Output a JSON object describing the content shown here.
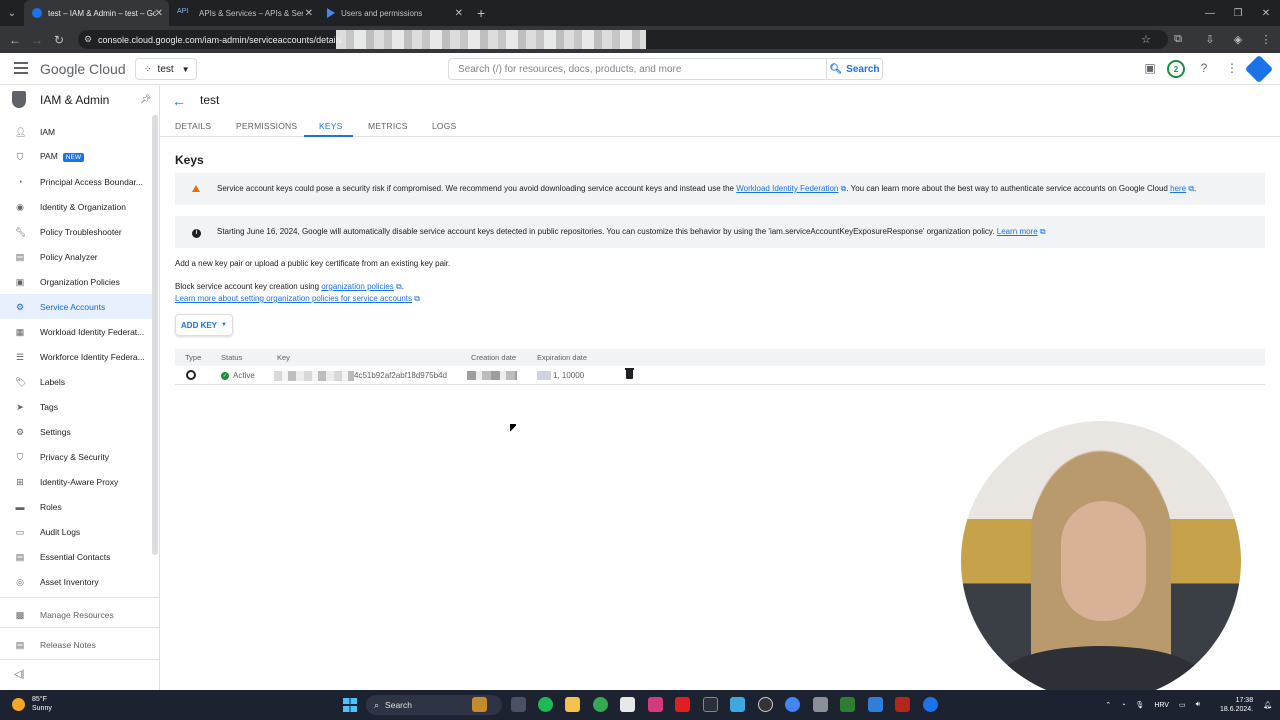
{
  "browser": {
    "tabs": [
      {
        "title": "test – IAM & Admin – test – Go",
        "active": true
      },
      {
        "title": "APIs & Services – APIs & Servic",
        "active": false
      },
      {
        "title": "Users and permissions",
        "active": false
      }
    ],
    "url": "console.cloud.google.com/iam-admin/serviceaccounts/details"
  },
  "header": {
    "logo": "Google Cloud",
    "project": "test",
    "search_placeholder": "Search (/) for resources, docs, products, and more",
    "search_button": "Search",
    "notification_count": "2"
  },
  "sidebar": {
    "title": "IAM & Admin",
    "items": [
      {
        "label": "IAM",
        "icon": "person-add-icon"
      },
      {
        "label": "PAM",
        "icon": "shield-icon",
        "badge": "NEW"
      },
      {
        "label": "Principal Access Boundar...",
        "icon": "policy-icon"
      },
      {
        "label": "Identity & Organization",
        "icon": "account-circle-icon"
      },
      {
        "label": "Policy Troubleshooter",
        "icon": "wrench-icon"
      },
      {
        "label": "Policy Analyzer",
        "icon": "document-search-icon"
      },
      {
        "label": "Organization Policies",
        "icon": "list-icon"
      },
      {
        "label": "Service Accounts",
        "icon": "service-account-icon",
        "active": true
      },
      {
        "label": "Workload Identity Federat...",
        "icon": "grid-icon"
      },
      {
        "label": "Workforce Identity Federa...",
        "icon": "list-icon"
      },
      {
        "label": "Labels",
        "icon": "label-icon"
      },
      {
        "label": "Tags",
        "icon": "tag-icon"
      },
      {
        "label": "Settings",
        "icon": "gear-icon"
      },
      {
        "label": "Privacy & Security",
        "icon": "shield-icon"
      },
      {
        "label": "Identity-Aware Proxy",
        "icon": "proxy-icon"
      },
      {
        "label": "Roles",
        "icon": "roles-icon"
      },
      {
        "label": "Audit Logs",
        "icon": "log-icon"
      },
      {
        "label": "Essential Contacts",
        "icon": "contacts-icon"
      },
      {
        "label": "Asset Inventory",
        "icon": "inventory-icon"
      }
    ],
    "footer_items": [
      {
        "label": "Manage Resources",
        "icon": "folder-icon"
      },
      {
        "label": "Release Notes",
        "icon": "notes-icon"
      }
    ]
  },
  "main": {
    "title": "test",
    "tabs": [
      "DETAILS",
      "PERMISSIONS",
      "KEYS",
      "METRICS",
      "LOGS"
    ],
    "active_tab": "KEYS",
    "section_title": "Keys",
    "warning": {
      "text1": "Service account keys could pose a security risk if compromised. We recommend you avoid downloading service account keys and instead use the ",
      "link1": "Workload Identity Federation",
      "text2": ". You can learn more about the best way to authenticate service accounts on Google Cloud ",
      "link2": "here",
      "text3": "."
    },
    "info": {
      "text": "Starting June 16, 2024, Google will automatically disable service account keys detected in public repositories. You can customize this behavior by using the 'iam.serviceAccountKeyExposureResponse' organization policy. ",
      "link": "Learn more"
    },
    "add_pair_text": "Add a new key pair or upload a public key certificate from an existing key pair.",
    "block_text": "Block service account key creation using ",
    "block_link": "organization policies",
    "block_end": ".",
    "learn_link": "Learn more about setting organization policies for service accounts",
    "add_key_button": "ADD KEY",
    "table": {
      "headers": [
        "Type",
        "Status",
        "Key",
        "Creation date",
        "Expiration date"
      ],
      "rows": [
        {
          "status": "Active",
          "key_suffix": "4c51b92af2abf18d975b4d",
          "expiration_suffix": "1, 10000"
        }
      ]
    }
  },
  "taskbar": {
    "weather_temp": "85°F",
    "weather_desc": "Sunny",
    "search": "Search",
    "lang": "HRV",
    "time": "17:38",
    "date": "18.6.2024."
  }
}
